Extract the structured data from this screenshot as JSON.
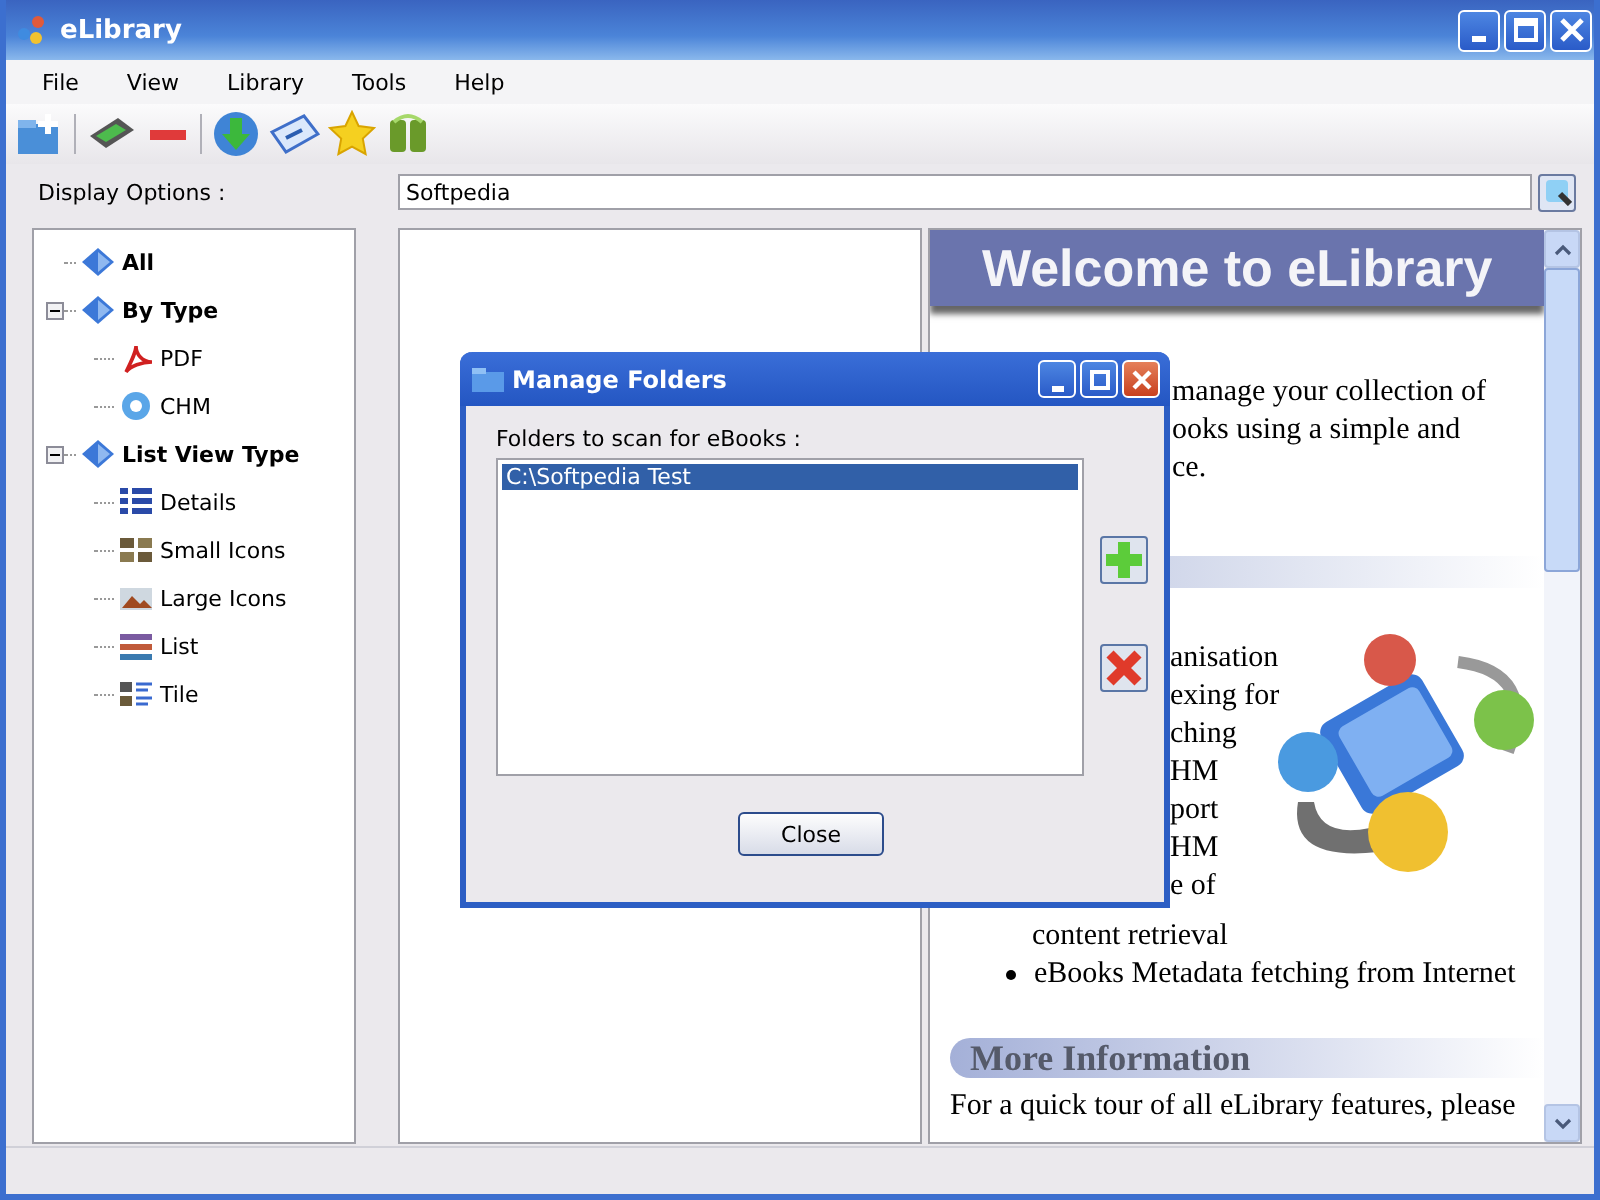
{
  "window": {
    "title": "eLibrary"
  },
  "menu": [
    "File",
    "View",
    "Library",
    "Tools",
    "Help"
  ],
  "display_options": {
    "label": "Display Options :"
  },
  "search": {
    "value": "Softpedia"
  },
  "tree": [
    {
      "label": "All",
      "kind": "book"
    },
    {
      "label": "By Type",
      "kind": "book",
      "expanded": true,
      "children": [
        {
          "label": "PDF",
          "kind": "pdf"
        },
        {
          "label": "CHM",
          "kind": "chm"
        }
      ]
    },
    {
      "label": "List View Type",
      "kind": "book",
      "expanded": true,
      "children": [
        {
          "label": "Details",
          "kind": "details"
        },
        {
          "label": "Small Icons",
          "kind": "small"
        },
        {
          "label": "Large Icons",
          "kind": "large"
        },
        {
          "label": "List",
          "kind": "list"
        },
        {
          "label": "Tile",
          "kind": "tile"
        }
      ]
    }
  ],
  "content": {
    "banner": "Welcome to eLibrary",
    "intro_fragments": [
      "manage your collection of",
      "ooks using a simple and",
      "ce."
    ],
    "feature_fragments": [
      "anisation",
      "exing for",
      "ching",
      "HM",
      "port",
      "HM",
      "e of"
    ],
    "feature_continuation": "content retrieval",
    "feature_item": "eBooks Metadata fetching from Internet",
    "more_heading": "More Information",
    "more_text": "For a quick tour of all eLibrary features, please"
  },
  "dialog": {
    "title": "Manage Folders",
    "label": "Folders to scan for eBooks :",
    "folders": [
      {
        "path": "C:\\Softpedia Test",
        "selected": true
      }
    ],
    "close": "Close"
  }
}
